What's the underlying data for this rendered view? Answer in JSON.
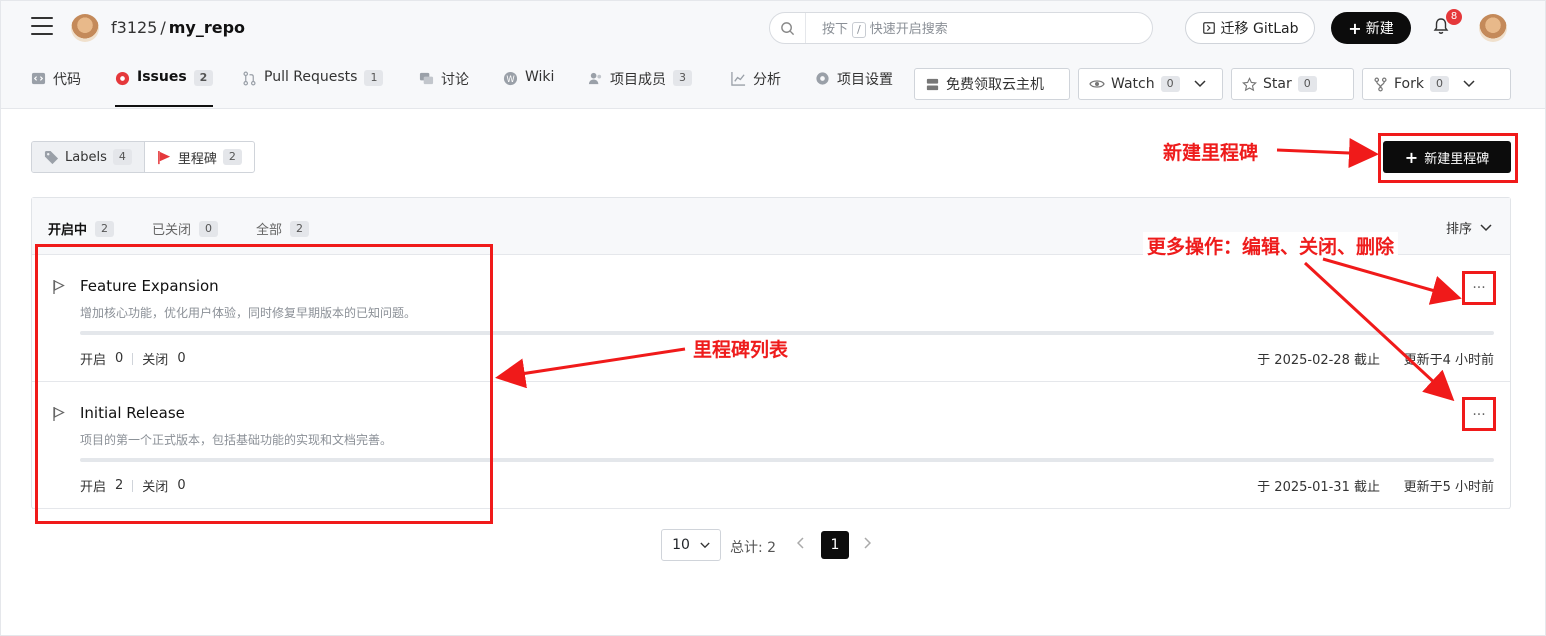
{
  "header": {
    "owner": "f3125",
    "separator": "/",
    "repo": "my_repo",
    "search": {
      "prefix": "按下",
      "key": "/",
      "suffix": "快速开启搜索"
    },
    "migrate_label": "迁移 GitLab",
    "new_label": "新建",
    "notification_count": "8"
  },
  "tabs": [
    {
      "label": "代码",
      "icon": "code-icon"
    },
    {
      "label": "Issues",
      "count": "2",
      "icon": "issues-icon",
      "active": true
    },
    {
      "label": "Pull Requests",
      "count": "1",
      "icon": "pull-request-icon"
    },
    {
      "label": "讨论",
      "icon": "discussion-icon"
    },
    {
      "label": "Wiki",
      "icon": "wiki-icon"
    },
    {
      "label": "项目成员",
      "count": "3",
      "icon": "members-icon"
    },
    {
      "label": "分析",
      "icon": "analytics-icon"
    },
    {
      "label": "项目设置",
      "icon": "settings-icon"
    }
  ],
  "repo_actions": {
    "cloud_label": "免费领取云主机",
    "watch": {
      "label": "Watch",
      "count": "0"
    },
    "star": {
      "label": "Star",
      "count": "0"
    },
    "fork": {
      "label": "Fork",
      "count": "0"
    }
  },
  "segments": {
    "labels": {
      "label": "Labels",
      "count": "4"
    },
    "milestones": {
      "label": "里程碑",
      "count": "2"
    }
  },
  "new_milestone_label": "新建里程碑",
  "filters": {
    "open": {
      "label": "开启中",
      "count": "2"
    },
    "closed": {
      "label": "已关闭",
      "count": "0"
    },
    "all": {
      "label": "全部",
      "count": "2"
    },
    "sort_label": "排序"
  },
  "milestones": [
    {
      "title": "Feature Expansion",
      "description": "增加核心功能，优化用户体验，同时修复早期版本的已知问题。",
      "progress": 0,
      "open_label": "开启",
      "open_count": "0",
      "closed_label": "关闭",
      "closed_count": "0",
      "due": "于 2025-02-28 截止",
      "updated": "更新于4 小时前"
    },
    {
      "title": "Initial Release",
      "description": "项目的第一个正式版本，包括基础功能的实现和文档完善。",
      "progress": 0,
      "open_label": "开启",
      "open_count": "2",
      "closed_label": "关闭",
      "closed_count": "0",
      "due": "于 2025-01-31 截止",
      "updated": "更新于5 小时前"
    }
  ],
  "pagination": {
    "page_size": "10",
    "total": "总计: 2",
    "current_page": "1"
  },
  "annotations": {
    "new_milestone": "新建里程碑",
    "more_actions": "更多操作：编辑、关闭、删除",
    "milestone_list": "里程碑列表",
    "color": "#f01a1a"
  }
}
